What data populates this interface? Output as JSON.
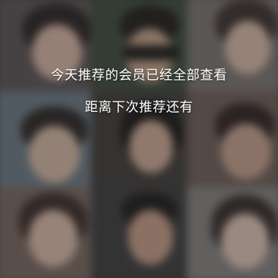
{
  "message": {
    "line1": "今天推荐的会员已经全部查看",
    "line2": "距离下次推荐还有"
  },
  "tiles": [
    {
      "name": "tile-1",
      "bg": "#5a5254",
      "face": "#d9b6a6",
      "hair": "#2a2222"
    },
    {
      "name": "tile-2",
      "bg": "#3d4a3c",
      "face": "#c9a48c",
      "hair": "#1e1c1b"
    },
    {
      "name": "tile-3",
      "bg": "#7a7472",
      "face": "#d8bba9",
      "hair": "#3a302c"
    },
    {
      "name": "tile-4",
      "bg": "#6b7a86",
      "face": "#d7b9a6",
      "hair": "#2a2524"
    },
    {
      "name": "tile-5",
      "bg": "#3e3a37",
      "face": "#d0ab97",
      "hair": "#181515"
    },
    {
      "name": "tile-6",
      "bg": "#6e5e58",
      "face": "#c9a190",
      "hair": "#2d2220"
    },
    {
      "name": "tile-7",
      "bg": "#7a6760",
      "face": "#dcbcab",
      "hair": "#3a2a26"
    },
    {
      "name": "tile-8",
      "bg": "#3b3a3d",
      "face": "#c79f88",
      "hair": "#1a1818"
    },
    {
      "name": "tile-9",
      "bg": "#858380",
      "face": "#e0c6b8",
      "hair": "#332a28"
    }
  ]
}
